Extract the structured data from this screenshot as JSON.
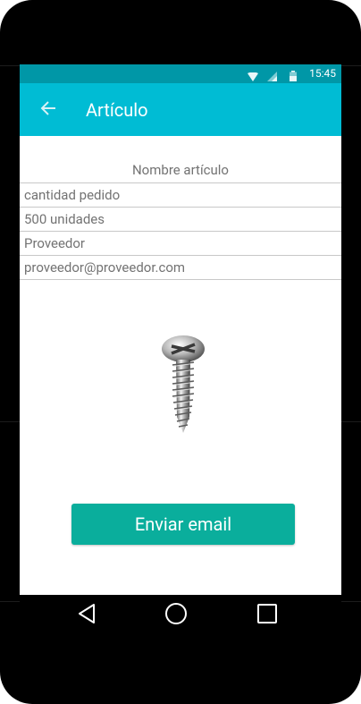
{
  "status_bar": {
    "time": "15:45",
    "icons": [
      "wifi-icon",
      "signal-icon",
      "battery-icon"
    ],
    "color": "#0097A7"
  },
  "app_bar": {
    "title": "Artículo",
    "back_icon": "arrow-back-icon",
    "color": "#00BCD4"
  },
  "product": {
    "name": "Nombre artículo",
    "fields": [
      "cantidad pedido",
      "500 unidades",
      "Proveedor",
      "proveedor@proveedor.com"
    ],
    "image": "screw-image"
  },
  "actions": {
    "send_label": "Enviar email",
    "send_color": "#0AAE9C"
  },
  "nav_bar": {
    "icons": [
      "back-triangle-icon",
      "home-circle-icon",
      "recents-square-icon"
    ]
  }
}
